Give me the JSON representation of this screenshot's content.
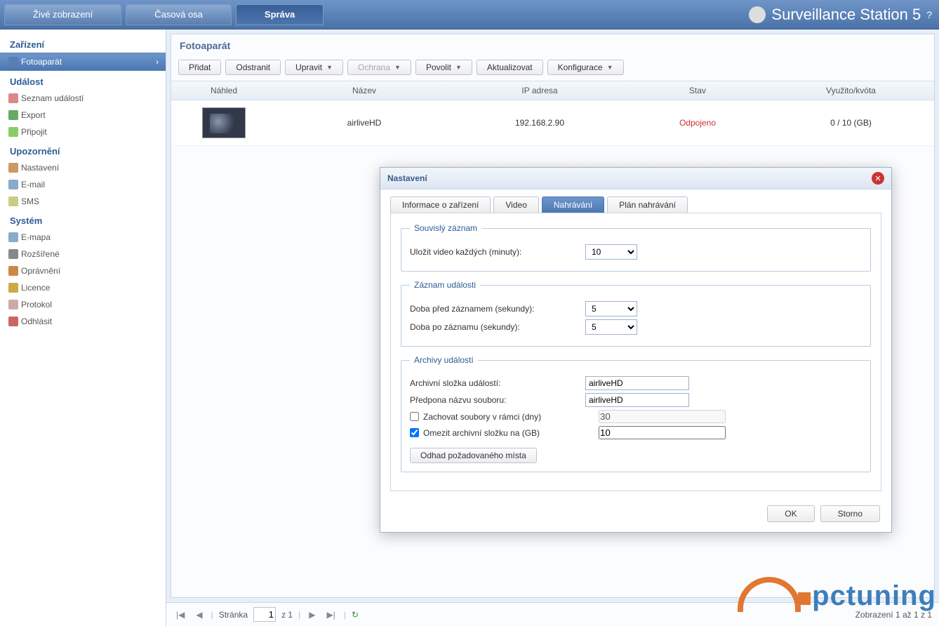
{
  "header": {
    "tabs": [
      "Živé zobrazení",
      "Časová osa",
      "Správa"
    ],
    "active_tab": 2,
    "title": "Surveillance Station 5"
  },
  "sidebar": {
    "groups": [
      {
        "title": "Zařízení",
        "items": [
          {
            "label": "Fotoaparát",
            "icon": "cam",
            "active": true
          }
        ]
      },
      {
        "title": "Událost",
        "items": [
          {
            "label": "Seznam událostí",
            "icon": "list"
          },
          {
            "label": "Export",
            "icon": "export"
          },
          {
            "label": "Připojit",
            "icon": "connect"
          }
        ]
      },
      {
        "title": "Upozornění",
        "items": [
          {
            "label": "Nastavení",
            "icon": "set"
          },
          {
            "label": "E-mail",
            "icon": "mail"
          },
          {
            "label": "SMS",
            "icon": "sms"
          }
        ]
      },
      {
        "title": "Systém",
        "items": [
          {
            "label": "E-mapa",
            "icon": "map"
          },
          {
            "label": "Rozšířené",
            "icon": "ext"
          },
          {
            "label": "Oprávnění",
            "icon": "perm"
          },
          {
            "label": "Licence",
            "icon": "lic"
          },
          {
            "label": "Protokol",
            "icon": "log"
          },
          {
            "label": "Odhlásit",
            "icon": "logout"
          }
        ]
      }
    ]
  },
  "main": {
    "title": "Fotoaparát",
    "toolbar": [
      {
        "label": "Přidat",
        "dropdown": false
      },
      {
        "label": "Odstranit",
        "dropdown": false
      },
      {
        "label": "Upravit",
        "dropdown": true
      },
      {
        "label": "Ochrana",
        "dropdown": true,
        "disabled": true
      },
      {
        "label": "Povolit",
        "dropdown": true
      },
      {
        "label": "Aktualizovat",
        "dropdown": false
      },
      {
        "label": "Konfigurace",
        "dropdown": true
      }
    ],
    "columns": {
      "thumb": "Náhled",
      "name": "Název",
      "ip": "IP adresa",
      "status": "Stav",
      "quota": "Využito/kvóta"
    },
    "rows": [
      {
        "name": "airliveHD",
        "ip": "192.168.2.90",
        "status": "Odpojeno",
        "quota": "0 / 10 (GB)"
      }
    ]
  },
  "pager": {
    "label": "Stránka",
    "page": "1",
    "of": "z 1",
    "summary": "Zobrazení 1 až 1 z 1"
  },
  "dialog": {
    "title": "Nastavení",
    "tabs": [
      "Informace o zařízení",
      "Video",
      "Nahrávání",
      "Plán nahrávání"
    ],
    "active_tab": 2,
    "continuous": {
      "legend": "Souvislý záznam",
      "save_label": "Uložit video každých (minuty):",
      "save_value": "10"
    },
    "event_rec": {
      "legend": "Záznam události",
      "pre_label": "Doba před záznamem (sekundy):",
      "pre_value": "5",
      "post_label": "Doba po záznamu (sekundy):",
      "post_value": "5"
    },
    "archives": {
      "legend": "Archivy událostí",
      "folder_label": "Archivní složka událostí:",
      "folder_value": "airliveHD",
      "prefix_label": "Předpona názvu souboru:",
      "prefix_value": "airliveHD",
      "keep_label": "Zachovat soubory v rámci (dny)",
      "keep_checked": false,
      "keep_value": "30",
      "limit_label": "Omezit archivní složku na (GB)",
      "limit_checked": true,
      "limit_value": "10",
      "estimate_btn": "Odhad požadovaného místa"
    },
    "buttons": {
      "ok": "OK",
      "cancel": "Storno"
    }
  },
  "watermark": "pctuning"
}
